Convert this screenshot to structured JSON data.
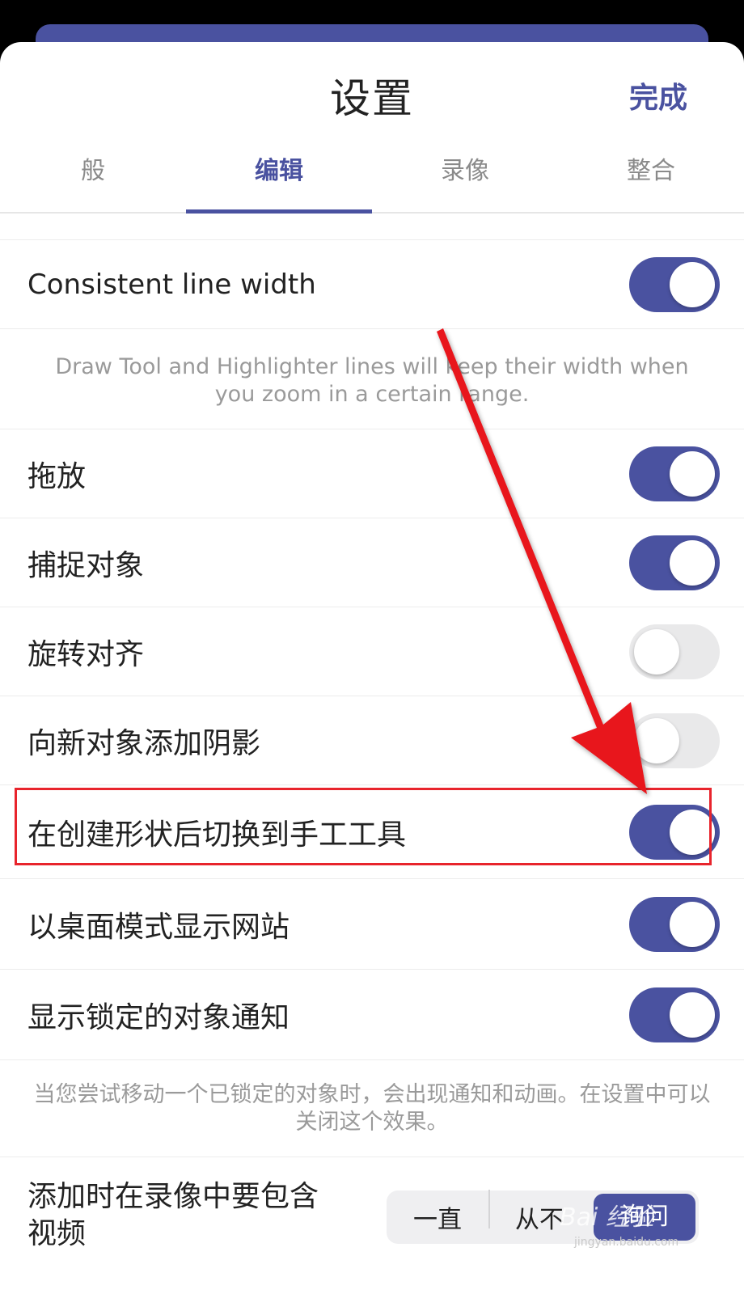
{
  "header": {
    "title": "设置",
    "done_label": "完成"
  },
  "tabs": [
    {
      "label": "般",
      "active": false
    },
    {
      "label": "编辑",
      "active": true
    },
    {
      "label": "录像",
      "active": false
    },
    {
      "label": "整合",
      "active": false
    }
  ],
  "settings": {
    "consistent_line_width": {
      "label": "Consistent line width",
      "on": true
    },
    "consistent_line_width_note": "Draw Tool and Highlighter lines will keep their width when you zoom in a certain range.",
    "drag_drop": {
      "label": "拖放",
      "on": true
    },
    "snap_objects": {
      "label": "捕捉对象",
      "on": true
    },
    "rotate_align": {
      "label": "旋转对齐",
      "on": false
    },
    "add_shadow": {
      "label": "向新对象添加阴影",
      "on": false
    },
    "switch_hand_tool": {
      "label": "在创建形状后切换到手工工具",
      "on": true
    },
    "desktop_mode": {
      "label": "以桌面模式显示网站",
      "on": true
    },
    "locked_notice": {
      "label": "显示锁定的对象通知",
      "on": true
    },
    "locked_notice_note": "当您尝试移动一个已锁定的对象时，会出现通知和动画。在设置中可以关闭这个效果。",
    "include_video": {
      "label_line1": "添加时在录像中要包含",
      "label_line2": "视频",
      "options": [
        "一直",
        "从不",
        "询问"
      ],
      "selected": "询问"
    }
  },
  "watermark": {
    "text": "Bai 经验",
    "sub": "jingyan.baidu.com"
  },
  "colors": {
    "accent": "#4a52a0",
    "annotation": "#e8242c"
  }
}
